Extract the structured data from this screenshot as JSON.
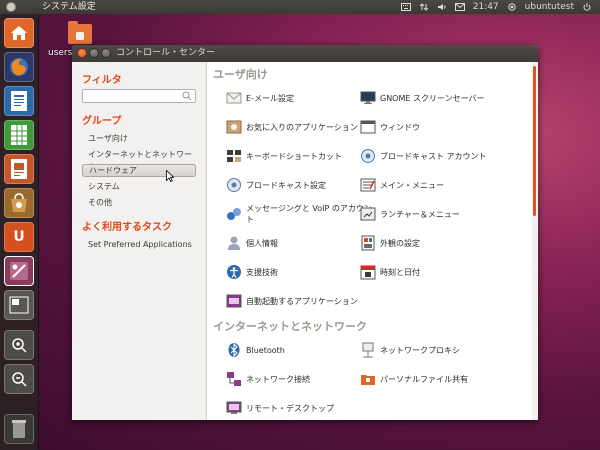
{
  "top_panel": {
    "app_title": "システム設定",
    "time": "21:47",
    "user": "ubuntutest"
  },
  "desktop": {
    "icon_label": "users"
  },
  "launcher": {
    "items": [
      {
        "icon": "home-folder-icon"
      },
      {
        "icon": "firefox-icon"
      },
      {
        "icon": "writer-icon"
      },
      {
        "icon": "calc-icon"
      },
      {
        "icon": "impress-icon"
      },
      {
        "icon": "software-center-icon"
      },
      {
        "icon": "ubuntu-one-icon"
      },
      {
        "icon": "system-settings-icon"
      },
      {
        "icon": "workspaces-icon"
      },
      {
        "icon": "zoom-in-icon"
      },
      {
        "icon": "zoom-out-icon"
      },
      {
        "icon": "trash-icon"
      }
    ]
  },
  "window": {
    "title": "コントロール・センター"
  },
  "sidebar": {
    "filter_heading": "フィルタ",
    "filter_value": "",
    "group_heading": "グループ",
    "groups": [
      "ユーザ向け",
      "インターネットとネットワーク",
      "ハードウェア",
      "システム",
      "その他"
    ],
    "selected_group": "ハードウェア",
    "frequent_heading": "よく利用するタスク",
    "frequent": [
      "Set Preferred Applications"
    ]
  },
  "main": {
    "sections": [
      {
        "title": "ユーザ向け",
        "items": [
          {
            "label": "E-メール設定",
            "icon": "email-icon"
          },
          {
            "label": "GNOME スクリーンセーバー",
            "icon": "monitor-icon"
          },
          {
            "label": "お気に入りのアプリケーション",
            "icon": "preferred-apps-icon"
          },
          {
            "label": "ウィンドウ",
            "icon": "window-icon"
          },
          {
            "label": "キーボードショートカット",
            "icon": "keyboard-icon"
          },
          {
            "label": "ブロードキャスト アカウント",
            "icon": "broadcast-icon"
          },
          {
            "label": "ブロードキャスト設定",
            "icon": "broadcast-settings-icon"
          },
          {
            "label": "メイン・メニュー",
            "icon": "main-menu-icon"
          },
          {
            "label": "メッセージングと VoIP のアカウント",
            "icon": "messaging-icon"
          },
          {
            "label": "ランチャー＆メニュー",
            "icon": "launcher-menu-icon"
          },
          {
            "label": "個人情報",
            "icon": "personal-info-icon"
          },
          {
            "label": "外観の設定",
            "icon": "appearance-icon"
          },
          {
            "label": "支援技術",
            "icon": "accessibility-icon"
          },
          {
            "label": "時刻と日付",
            "icon": "calendar-icon"
          },
          {
            "label": "自動起動するアプリケーション",
            "icon": "startup-apps-icon"
          }
        ]
      },
      {
        "title": "インターネットとネットワーク",
        "items": [
          {
            "label": "Bluetooth",
            "icon": "bluetooth-icon"
          },
          {
            "label": "ネットワークプロキシ",
            "icon": "proxy-icon"
          },
          {
            "label": "ネットワーク接続",
            "icon": "network-icon"
          },
          {
            "label": "パーソナルファイル共有",
            "icon": "file-sharing-icon"
          },
          {
            "label": "リモート・デスクトップ",
            "icon": "remote-desktop-icon"
          }
        ]
      }
    ]
  }
}
